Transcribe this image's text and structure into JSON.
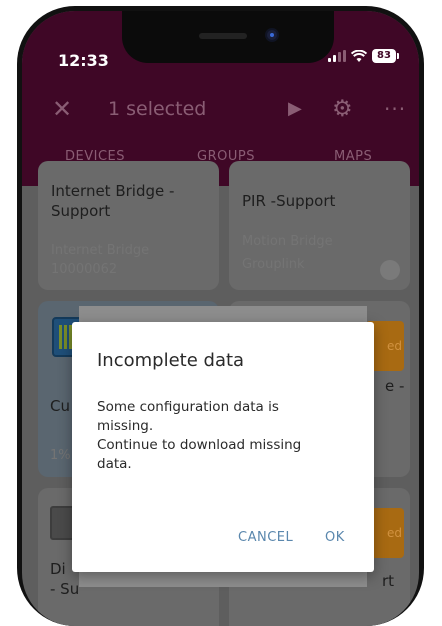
{
  "status_bar": {
    "time": "12:33",
    "battery": "83",
    "wifi_icon": "wifi-icon",
    "signal_icon": "signal-bars-icon"
  },
  "toolbar": {
    "title": "1 selected",
    "close_icon": "close-icon",
    "play_icon": "play-icon",
    "settings_icon": "gear-icon",
    "more_icon": "more-horizontal-icon"
  },
  "tabs": [
    {
      "label": "DEVICES"
    },
    {
      "label": "GROUPS"
    },
    {
      "label": "MAPS"
    }
  ],
  "cards": [
    {
      "title_line1": "Internet Bridge -",
      "title_line2": "Support",
      "sub_line1": "Internet Bridge",
      "sub_line2": "10000062"
    },
    {
      "title_line1": "PIR -Support",
      "sub_line1": "Motion Bridge",
      "sub_line2": "Grouplink"
    },
    {
      "title_short": "Cu",
      "sub_short": "1%"
    },
    {
      "title_short": "e -",
      "badge": "ed"
    },
    {
      "title_line1": "Di",
      "title_line2": "- Su"
    },
    {
      "title_short": "rt",
      "badge": "ed"
    }
  ],
  "dialog": {
    "title": "Incomplete data",
    "body_line1": "Some configuration data is",
    "body_line2": "missing.",
    "body_line3": "Continue to download missing",
    "body_line4": "data.",
    "cancel_label": "CANCEL",
    "ok_label": "OK"
  },
  "colors": {
    "app_bar": "#3f0726",
    "accent_button": "#5a87ad",
    "scrim": "#5e5e5e",
    "dialog_bg": "#ffffff"
  }
}
